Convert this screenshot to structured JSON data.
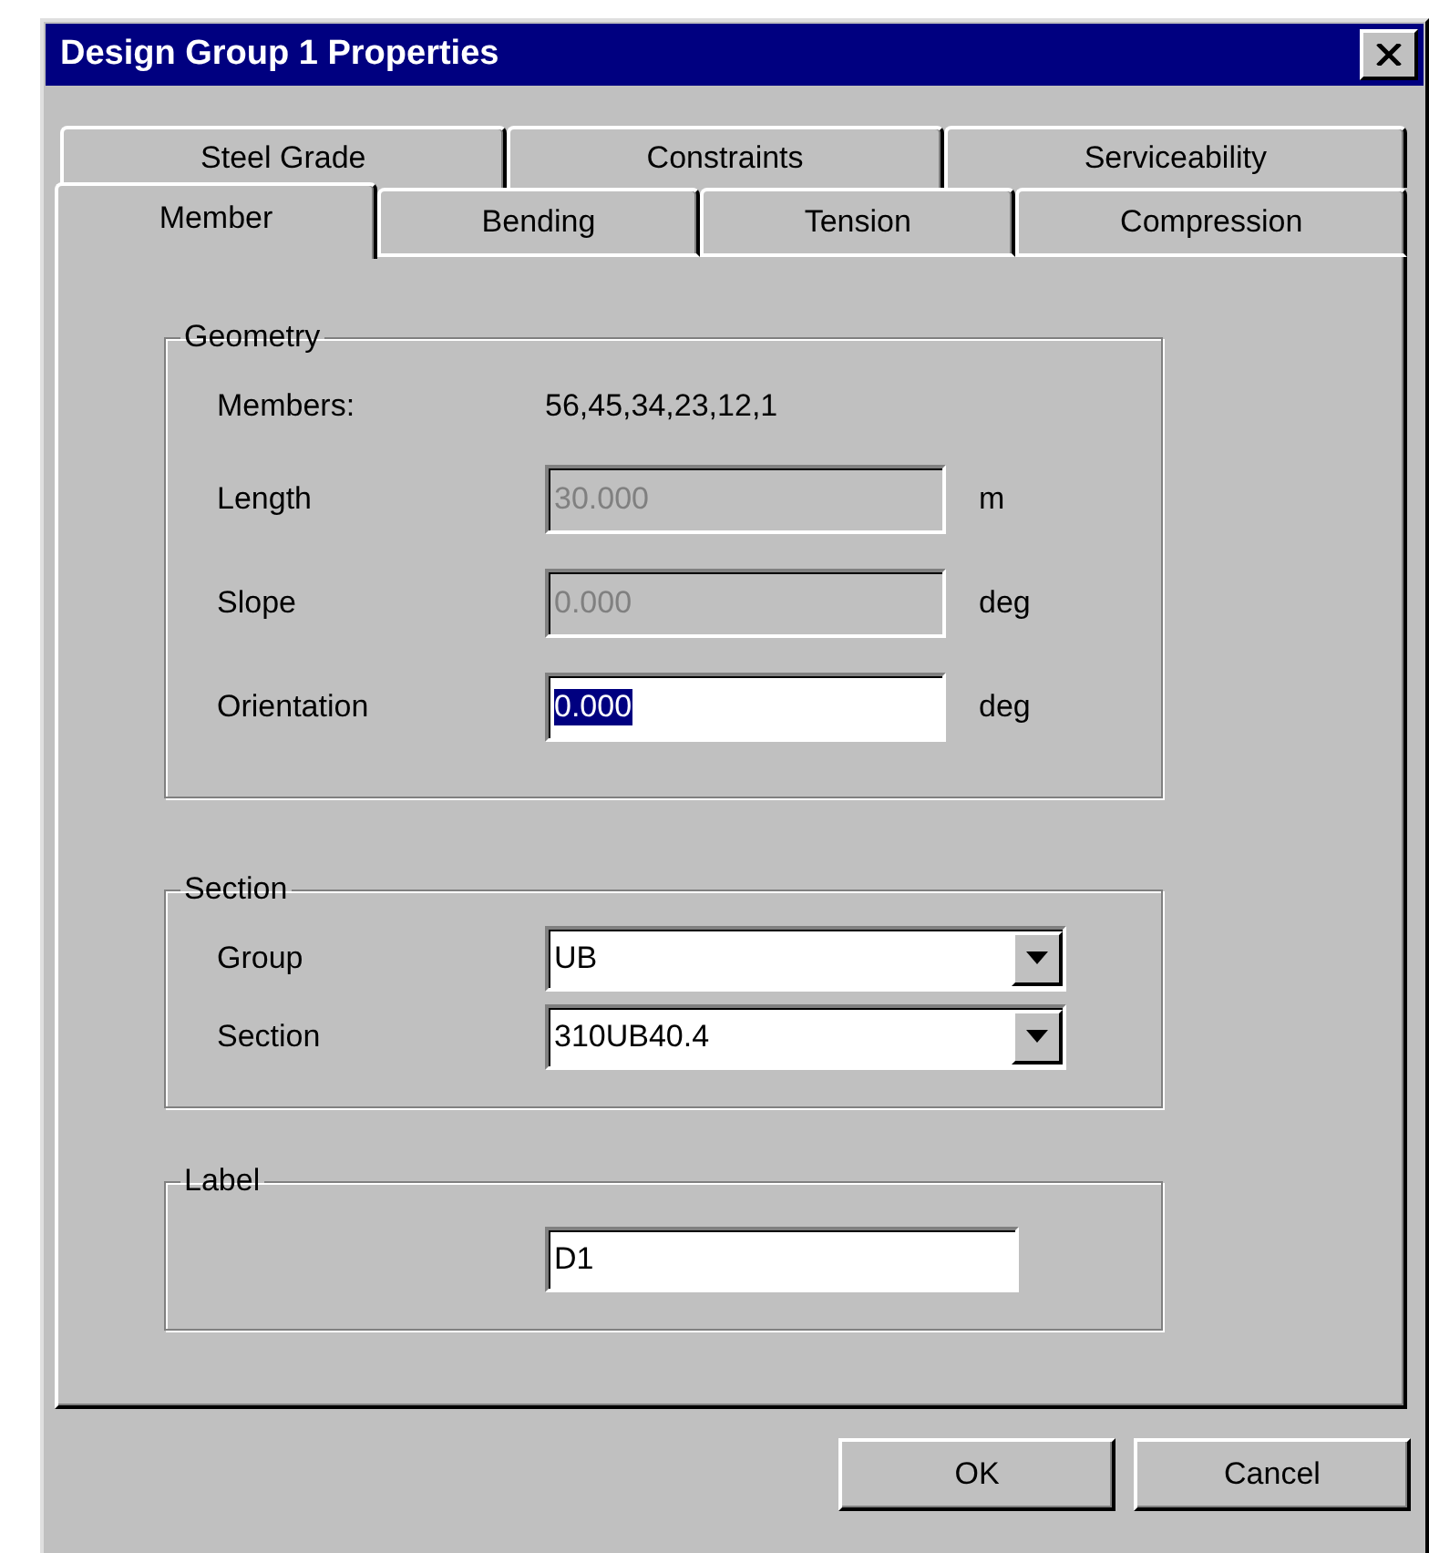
{
  "window": {
    "title": "Design Group 1 Properties"
  },
  "tab_rows": [
    {
      "tabs": [
        {
          "label": "Steel Grade",
          "selected": false
        },
        {
          "label": "Constraints",
          "selected": false
        },
        {
          "label": "Serviceability",
          "selected": false
        }
      ]
    },
    {
      "tabs": [
        {
          "label": "Member",
          "selected": true
        },
        {
          "label": "Bending",
          "selected": false
        },
        {
          "label": "Tension",
          "selected": false
        },
        {
          "label": "Compression",
          "selected": false
        }
      ]
    }
  ],
  "geometry": {
    "title": "Geometry",
    "members_label": "Members:",
    "members_value": "56,45,34,23,12,1",
    "fields": [
      {
        "label": "Length",
        "value": "30.000",
        "unit": "m",
        "disabled": true,
        "highlighted": false
      },
      {
        "label": "Slope",
        "value": "0.000",
        "unit": "deg",
        "disabled": true,
        "highlighted": false
      },
      {
        "label": "Orientation",
        "value": "0.000",
        "unit": "deg",
        "disabled": false,
        "highlighted": true
      }
    ]
  },
  "section": {
    "title": "Section",
    "dropdowns": [
      {
        "label": "Group",
        "value": "UB"
      },
      {
        "label": "Section",
        "value": "310UB40.4"
      }
    ]
  },
  "label": {
    "title": "Label",
    "value": "D1"
  },
  "buttons": [
    {
      "label": "OK"
    },
    {
      "label": "Cancel"
    }
  ]
}
